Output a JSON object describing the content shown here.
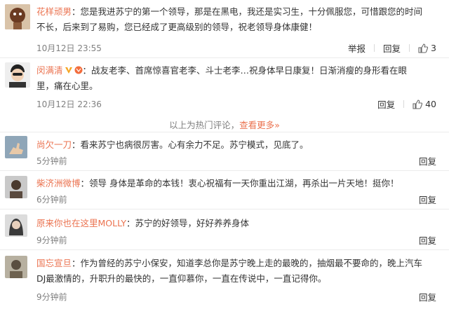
{
  "hot_comments": [
    {
      "name": "花样顽男",
      "text": "：您是我进苏宁的第一个领导，那是在黑电，我还是实习生，十分佩服您，可惜跟您的时间不长，后来到了易购，您已经成了更高级别的领导，祝老领导身体康健！",
      "line1": "：您是我进苏宁的第一个领导，那是在黑电，我还是实习生，十分佩服您，可惜跟您的时间",
      "line2": "不长，后来到了易购，您已经成了更高级别的领导，祝老领导身体康健！",
      "time": "10月12日 23:55",
      "report": "举报",
      "reply": "回复",
      "likes": "3"
    },
    {
      "name": "闵满清",
      "line1": "：战友老李、首席惊喜官老李、斗士老李…祝身体早日康复！日渐消瘦的身形看在眼",
      "line2": "里，痛在心里。",
      "time": "10月12日 22:36",
      "reply": "回复",
      "likes": "40"
    }
  ],
  "hot_divider": {
    "label": "以上为热门评论，",
    "more": "查看更多",
    "more_arrow": "»"
  },
  "comments": [
    {
      "name": "尚欠一刀",
      "text": "：看来苏宁也病很厉害。心有余力不足。苏宁模式，见底了。",
      "time": "5分钟前",
      "reply": "回复"
    },
    {
      "name": "柴济洲微博",
      "text": "：领导 身体是革命的本钱！衷心祝福有一天你重出江湖，再杀出一片天地！挺你！",
      "time": "6分钟前",
      "reply": "回复"
    },
    {
      "name": "原来你也在这里MOLLY",
      "text": "：苏宁的好领导，好好养养身体",
      "time": "9分钟前",
      "reply": "回复"
    },
    {
      "name": "国忘宣旦",
      "line1": "：作为曾经的苏宁小保安，知道李总你是苏宁晚上走的最晚的，抽烟最不要命的，晚上汽车",
      "line2": "DJ最激情的，升职升的最快的，一直仰慕你，一直在传说中，一直记得你。",
      "time": "9分钟前",
      "reply": "回复"
    }
  ]
}
